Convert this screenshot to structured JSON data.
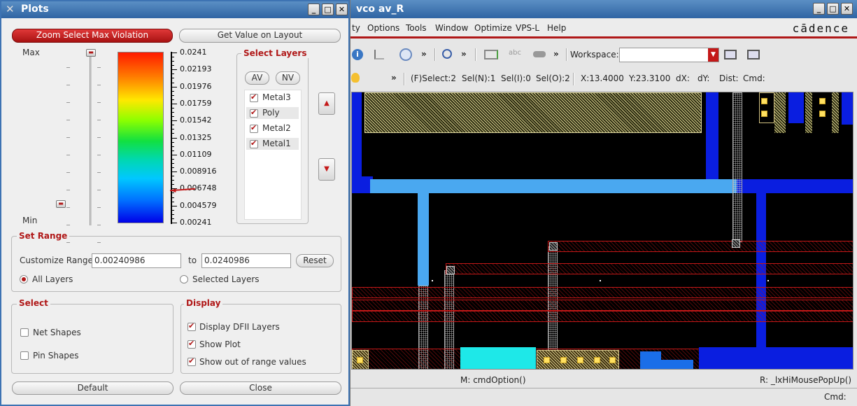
{
  "plots": {
    "title": "Plots",
    "zoom_btn": "Zoom Select Max Violation",
    "get_value_btn": "Get Value on Layout",
    "slider_max": "Max",
    "slider_min": "Min",
    "scale": [
      "0.0241",
      "0.02193",
      "0.01976",
      "0.01759",
      "0.01542",
      "0.01325",
      "0.01109",
      "0.008916",
      "0.006748",
      "0.004579",
      "0.00241"
    ],
    "select_layers": {
      "label": "Select Layers",
      "av": "AV",
      "nv": "NV",
      "layers": [
        {
          "name": "Metal3",
          "checked": true
        },
        {
          "name": "Poly",
          "checked": true
        },
        {
          "name": "Metal2",
          "checked": true
        },
        {
          "name": "Metal1",
          "checked": true
        }
      ]
    },
    "set_range": {
      "label": "Set Range",
      "customize_label": "Customize Range",
      "from": "0.00240986",
      "to_label": "to",
      "to": "0.0240986",
      "reset": "Reset",
      "all_layers": "All Layers",
      "selected_layers": "Selected Layers"
    },
    "select": {
      "label": "Select",
      "net_shapes": "Net Shapes",
      "pin_shapes": "Pin Shapes"
    },
    "display": {
      "label": "Display",
      "dfii": "Display DFII Layers",
      "show_plot": "Show Plot",
      "out_of_range": "Show out of range values"
    },
    "default_btn": "Default",
    "close_btn": "Close"
  },
  "vco": {
    "title": "vco av_R",
    "menu": [
      "ty",
      "Options",
      "Tools",
      "Window",
      "Optimize",
      "VPS-L",
      "Help"
    ],
    "brand": "cādence",
    "workspace_label": "Workspace:",
    "status": {
      "fselect": "(F)Select:2",
      "seln": "Sel(N):1",
      "seli": "Sel(I):0",
      "selo": "Sel(O):2",
      "x": "X:13.4000",
      "y": "Y:23.3100",
      "dx": "dX:",
      "dy": "dY:",
      "dist": "Dist:",
      "cmd": "Cmd:"
    },
    "bottom": {
      "m": "M: cmdOption()",
      "r": "R: _lxHiMousePopUp()",
      "cmd": "Cmd:"
    }
  },
  "colors": {
    "accent_red": "#b01818",
    "title_blue": "#3d73b3",
    "layout_bg": "#000000",
    "metal1": "#0a1ee0",
    "metal_light": "#4aa8f0"
  }
}
